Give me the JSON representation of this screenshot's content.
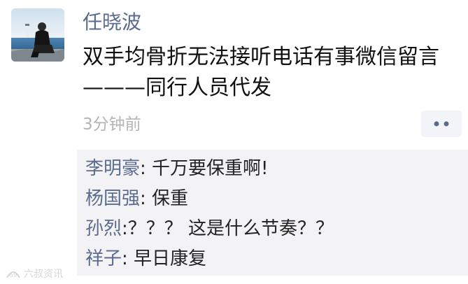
{
  "post": {
    "author": "任晓波",
    "text_line1": "双手均骨折无法接听电话有事微信留言",
    "text_line2": "———同行人员代发",
    "time": "3分钟前",
    "more_button": "••"
  },
  "comments": [
    {
      "name": "李明豪",
      "sep": ": ",
      "text": "千万要保重啊!"
    },
    {
      "name": "杨国强",
      "sep": ": ",
      "text": "保重"
    },
    {
      "name": "孙烈",
      "sep": ":",
      "text": "？？？ 这是什么节奏？？"
    },
    {
      "name": "祥子",
      "sep": ": ",
      "text": "早日康复"
    }
  ],
  "watermark": {
    "logo_text": "69",
    "text": "六叔资讯"
  },
  "colors": {
    "name_blue": "#5b6b8e",
    "comment_bg": "#f3f3f5",
    "time_gray": "#b5b5b5"
  }
}
